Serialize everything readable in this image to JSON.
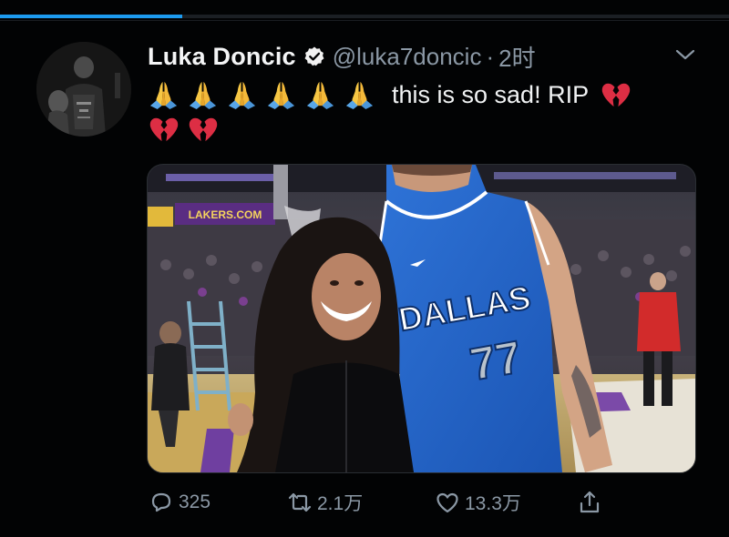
{
  "progress": {
    "fraction": 0.25,
    "color": "#1d9bf0"
  },
  "author": {
    "display_name": "Luka Doncic",
    "verified_icon": "verified-badge-icon",
    "handle": "@luka7doncic",
    "separator": "·",
    "time": "2时"
  },
  "tweet": {
    "emojis_line1": [
      "folded-hands-emoji",
      "folded-hands-emoji",
      "folded-hands-emoji",
      "folded-hands-emoji",
      "folded-hands-emoji",
      "folded-hands-emoji"
    ],
    "text": "this is so sad! RIP",
    "trailing_emoji": "broken-heart-emoji",
    "emojis_line2": [
      "broken-heart-emoji",
      "broken-heart-emoji"
    ]
  },
  "media": {
    "description_icon": "photo",
    "jersey_text": "DALLAS",
    "jersey_number": "77",
    "sign_text": "LAKERS.COM"
  },
  "actions": {
    "reply": {
      "icon": "reply-icon",
      "count": "325"
    },
    "retweet": {
      "icon": "retweet-icon",
      "count": "2.1万"
    },
    "like": {
      "icon": "heart-icon",
      "count": "13.3万"
    },
    "share": {
      "icon": "share-icon"
    }
  },
  "colors": {
    "background": "#020304",
    "text": "#f1f3f4",
    "muted": "#8b98a5",
    "verified": "#ffffff"
  }
}
